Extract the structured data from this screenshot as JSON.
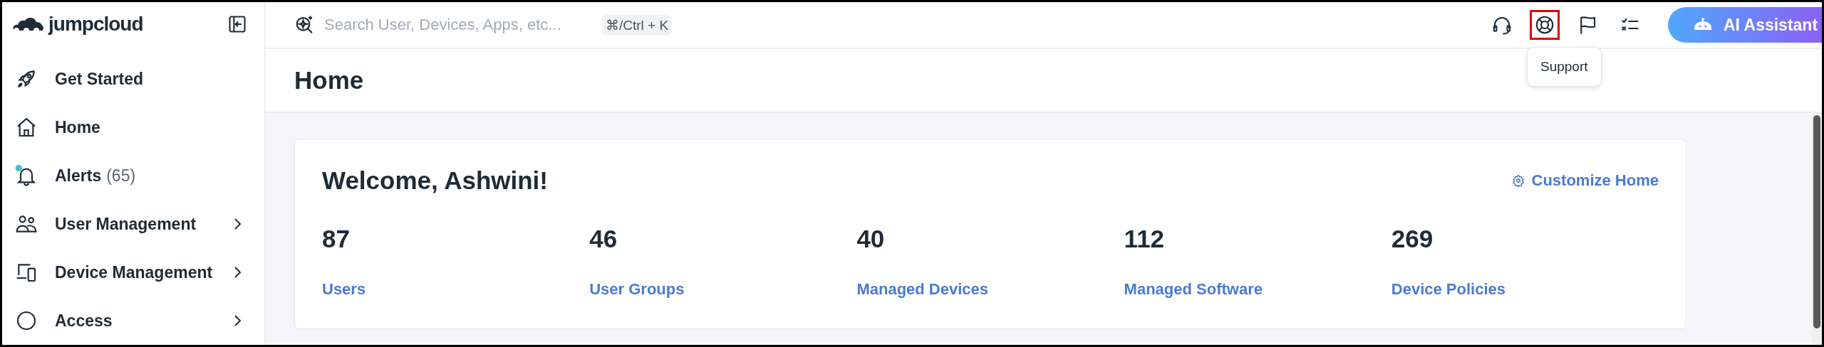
{
  "logo": {
    "text": "jumpcloud"
  },
  "sidebar": {
    "items": [
      {
        "kind": "rocket",
        "label": "Get Started"
      },
      {
        "kind": "home",
        "label": "Home"
      },
      {
        "kind": "bell",
        "label": "Alerts",
        "count": "(65)"
      },
      {
        "kind": "users",
        "label": "User Management",
        "expandable": true
      },
      {
        "kind": "devices",
        "label": "Device Management",
        "expandable": true
      },
      {
        "kind": "access",
        "label": "Access",
        "expandable": true
      }
    ]
  },
  "search": {
    "placeholder": "Search User, Devices, Apps, etc...",
    "shortcut": "⌘/Ctrl + K"
  },
  "toolbar": {
    "icons": [
      {
        "kind": "headset",
        "highlighted": false
      },
      {
        "kind": "lifebuoy",
        "highlighted": true
      },
      {
        "kind": "flag",
        "highlighted": false
      },
      {
        "kind": "checklist",
        "highlighted": false
      }
    ],
    "tooltip": "Support",
    "assistant_button": "AI Assistant"
  },
  "page": {
    "title": "Home"
  },
  "welcome": {
    "heading": "Welcome, Ashwini!",
    "customize_link": "Customize Home",
    "stats": [
      {
        "value": "87",
        "label": "Users"
      },
      {
        "value": "46",
        "label": "User Groups"
      },
      {
        "value": "40",
        "label": "Managed Devices"
      },
      {
        "value": "112",
        "label": "Managed Software"
      },
      {
        "value": "269",
        "label": "Device Policies"
      }
    ]
  }
}
